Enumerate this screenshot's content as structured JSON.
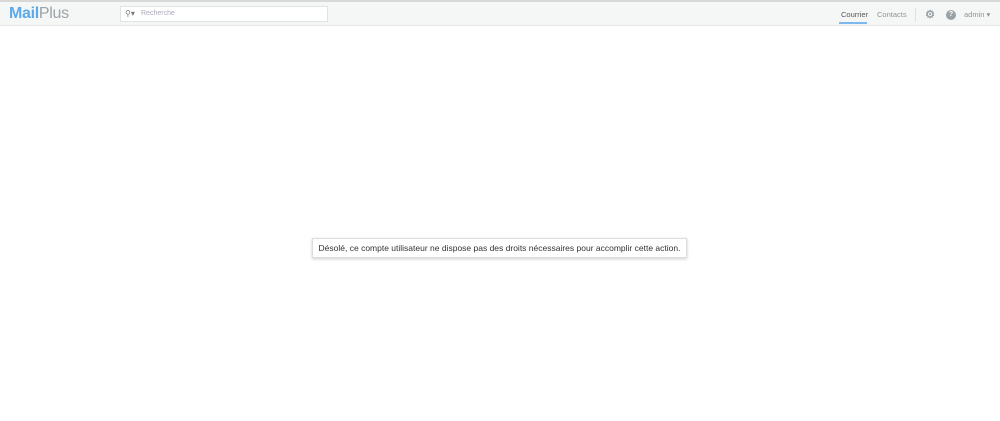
{
  "header": {
    "logo_mail": "Mail",
    "logo_plus": "Plus",
    "search_placeholder": "Recherche",
    "nav": [
      "Courrier",
      "Contacts"
    ],
    "user": "admin"
  },
  "message": "Désolé, ce compte utilisateur ne dispose pas des droits nécessaires pour accomplir cette action."
}
